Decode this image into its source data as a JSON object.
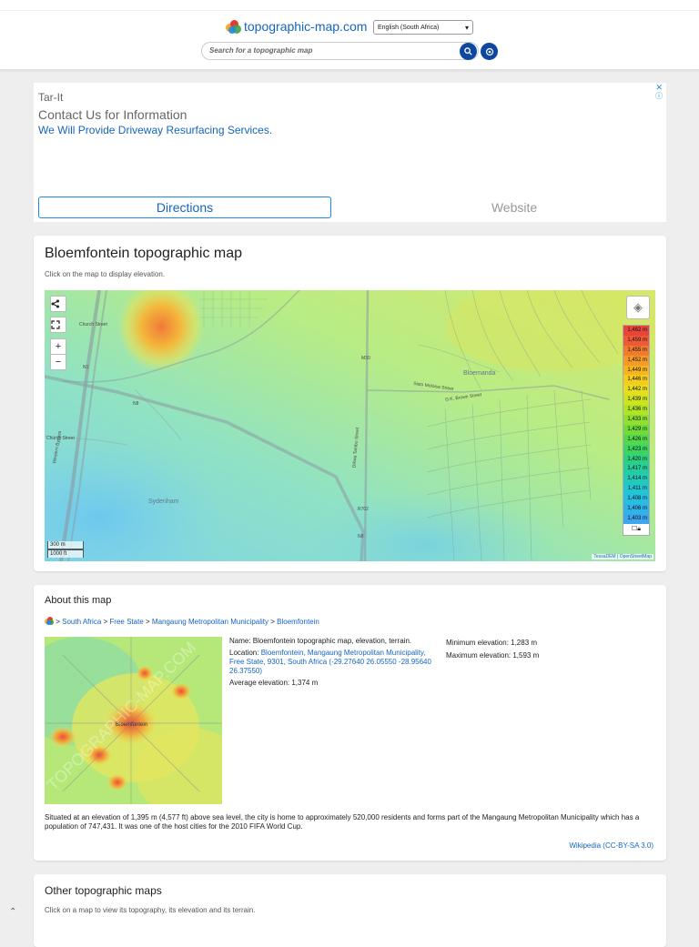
{
  "header": {
    "site_name": "topographic-map.com",
    "language": "English (South Africa)",
    "search_placeholder": "Search for a topographic map"
  },
  "ad": {
    "brand": "Tar-It",
    "headline": "Contact Us for Information",
    "description": "We Will Provide Driveway Resurfacing Services.",
    "directions_label": "Directions",
    "website_label": "Website"
  },
  "map_card": {
    "title": "Bloemfontein topographic map",
    "subtitle": "Click on the map to display elevation.",
    "legend": [
      "1,462 m",
      "1,459 m",
      "1,455 m",
      "1,452 m",
      "1,449 m",
      "1,446 m",
      "1,442 m",
      "1,439 m",
      "1,436 m",
      "1,433 m",
      "1,429 m",
      "1,426 m",
      "1,423 m",
      "1,420 m",
      "1,417 m",
      "1,414 m",
      "1,411 m",
      "1,408 m",
      "1,406 m",
      "1,403 m"
    ],
    "legend_colors": [
      "#e8443a",
      "#ee5a35",
      "#f27a2c",
      "#f59a24",
      "#f6b51e",
      "#f3cc1c",
      "#e6dd1c",
      "#cfe41e",
      "#b0e526",
      "#8fe02f",
      "#6fdc3a",
      "#52d84a",
      "#3cd462",
      "#2dd07e",
      "#25cd9c",
      "#22cab8",
      "#22c6d0",
      "#26bfe2",
      "#2eb4ea",
      "#3aa7ee"
    ],
    "scale_metric": "300 m",
    "scale_imperial": "1000 ft",
    "attribution_1": "TessaDEM",
    "attribution_2": "OpenStreetMap",
    "labels": {
      "church_street_top": "Church Street",
      "church_street_left": "Church Street",
      "n1_top": "N1",
      "n1_bottom": "N1",
      "n8": "N8",
      "m30": "M30",
      "r702": "R702",
      "n8_lower": "N8",
      "sydenham": "Sydenham",
      "bloemanda": "Bloemanda",
      "western_bypass": "Western Bypass",
      "ditlhare": "Dikwa Tambo Street",
      "sisto": "Sisto Moloisa Street",
      "gk_brown": "G.K. Brown Street"
    },
    "share_icon": "share-icon",
    "fullscreen_icon": "fullscreen-icon",
    "zoom_in": "+",
    "zoom_out": "−"
  },
  "about_card": {
    "title": "About this map",
    "breadcrumb": [
      "South Africa",
      "Free State",
      "Mangaung Metropolitan Municipality",
      "Bloemfontein"
    ],
    "breadcrumb_sep": ">",
    "name_line": "Name: Bloemfontein topographic map, elevation, terrain.",
    "location_label": "Location:",
    "location_link": "Bloemfontein, Mangaung Metropolitan Municipality, Free State, 9301, South Africa (-29.27640 26.05550 -28.95640 26.37550)",
    "average_elevation": "Average elevation: 1,374 m",
    "min_elevation": "Minimum elevation: 1,283 m",
    "max_elevation": "Maximum elevation: 1,593 m",
    "description": "Situated at an elevation of 1,395 m (4,577 ft) above sea level, the city is home to approximately 520,000 residents and forms part of the Mangaung Metropolitan Municipality which has a population of 747,431. It was one of the host cities for the 2010 FIFA World Cup.",
    "wiki_link": "Wikipedia (CC-BY-SA 3.0)",
    "thumb_watermark": "TOPOGRAPHIC-MAP.COM",
    "thumb_city": "Bloemfontein"
  },
  "other_card": {
    "title": "Other topographic maps",
    "subtitle": "Click on a map to view its topography, its elevation and its terrain."
  },
  "scroll_top_icon": "chevron-up-icon",
  "scroll_top_glyph": "⌃"
}
